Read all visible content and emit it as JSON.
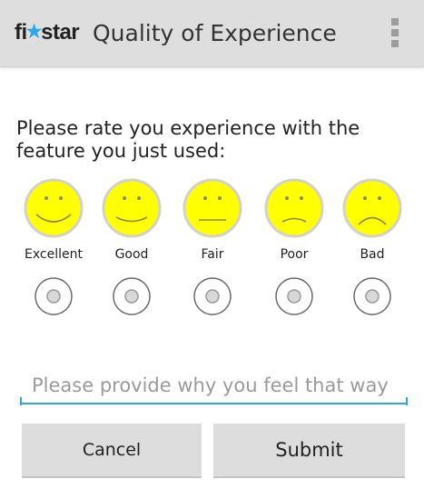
{
  "action_bar": {
    "logo_text_before": "fi",
    "logo_star": "★",
    "logo_text_after": "star",
    "title": "Quality of Experience",
    "overflow_icon": "overflow-menu-icon"
  },
  "prompt": "Please rate you experience with the feature you just used:",
  "ratings": [
    {
      "label": "Excellent",
      "icon": "very-happy-face-icon"
    },
    {
      "label": "Good",
      "icon": "happy-face-icon"
    },
    {
      "label": "Fair",
      "icon": "neutral-face-icon"
    },
    {
      "label": "Poor",
      "icon": "sad-face-icon"
    },
    {
      "label": "Bad",
      "icon": "very-sad-face-icon"
    }
  ],
  "comment": {
    "placeholder": "Please provide why you feel that way",
    "value": ""
  },
  "buttons": {
    "cancel": "Cancel",
    "submit": "Submit"
  },
  "colors": {
    "action_bar_bg": "#dedede",
    "face_fill": "#ffff00",
    "input_accent": "#33a5d6",
    "logo_star": "#2aa7e8",
    "button_bg": "#dddddd"
  }
}
